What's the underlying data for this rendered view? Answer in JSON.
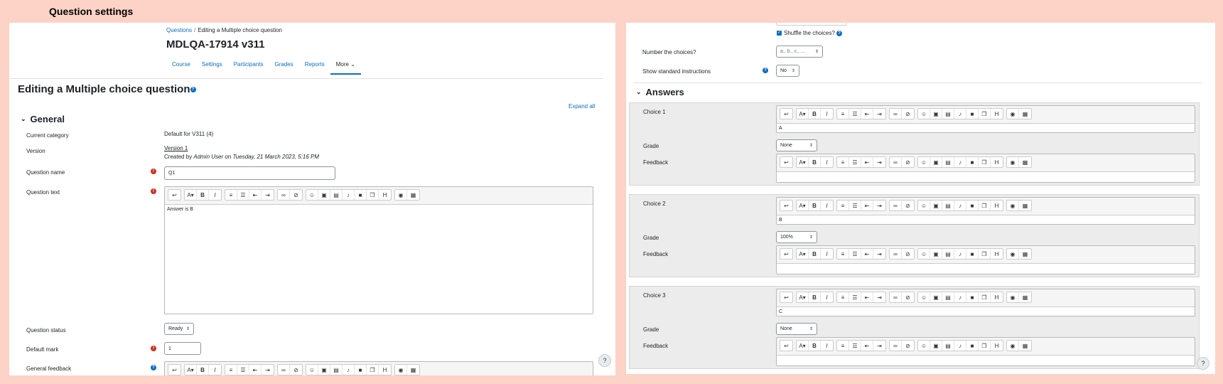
{
  "page": {
    "title": "Question settings"
  },
  "left": {
    "breadcrumb": [
      "Questions",
      "Editing a Multiple choice question"
    ],
    "course_title": "MDLQA-17914 v311",
    "nav": [
      "Course",
      "Settings",
      "Participants",
      "Grades",
      "Reports",
      "More"
    ],
    "heading": "Editing a Multiple choice question",
    "expand_all": "Expand all",
    "section_general": "General",
    "fields": {
      "current_category_label": "Current category",
      "current_category_value": "Default for V311 (4)",
      "version_label": "Version",
      "version_value": "Version 1",
      "version_created_prefix": "Created by ",
      "version_created_user": "Admin User",
      "version_created_on": " on ",
      "version_created_date": "Tuesday, 21 March 2023, 5:16 PM",
      "question_name_label": "Question name",
      "question_name_value": "Q1",
      "question_text_label": "Question text",
      "question_text_value": "Answer is B",
      "question_status_label": "Question status",
      "question_status_value": "Ready",
      "default_mark_label": "Default mark",
      "default_mark_value": "1",
      "general_feedback_label": "General feedback"
    },
    "help_button": "?"
  },
  "right": {
    "shuffle_label": "Shuffle the choices?",
    "number_choices_label": "Number the choices?",
    "number_choices_value": "a., b., c., ...",
    "show_instructions_label": "Show standard instructions",
    "show_instructions_value": "No",
    "section_answers": "Answers",
    "choices": [
      {
        "label": "Choice 1",
        "text": "A",
        "grade_label": "Grade",
        "grade": "None",
        "feedback_label": "Feedback"
      },
      {
        "label": "Choice 2",
        "text": "B",
        "grade_label": "Grade",
        "grade": "100%",
        "feedback_label": "Feedback"
      },
      {
        "label": "Choice 3",
        "text": "C",
        "grade_label": "Grade",
        "grade": "None",
        "feedback_label": "Feedback"
      }
    ],
    "help_button": "?"
  },
  "toolbar_icons": [
    "undo-icon",
    "font-color-icon",
    "bold-icon",
    "italic-icon",
    "unordered-list-icon",
    "ordered-list-icon",
    "outdent-icon",
    "indent-icon",
    "link-icon",
    "unlink-icon",
    "emoji-icon",
    "image-icon",
    "media-icon",
    "record-audio-icon",
    "record-video-icon",
    "manage-files-icon",
    "h5p-icon",
    "accessibility-icon",
    "table-icon"
  ],
  "colors": {
    "background": "#fcd3c6",
    "link": "#0f6cbf",
    "required": "#ca3120"
  }
}
